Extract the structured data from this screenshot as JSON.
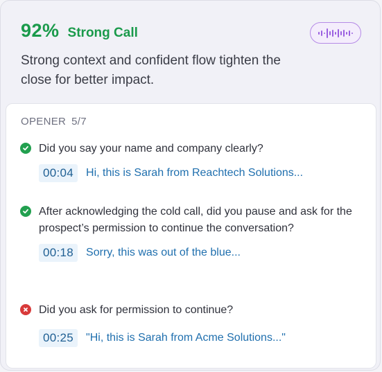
{
  "header": {
    "score": "92%",
    "rating": "Strong Call",
    "summary": "Strong context and confident flow tighten the close for better impact.",
    "audio_icon": "waveform-icon"
  },
  "section": {
    "name": "OPENER",
    "count": "5/7"
  },
  "items": [
    {
      "status": "passed",
      "status_icon": "check-circle-icon",
      "question": "Did you say your name and company clearly?",
      "timestamp": "00:04",
      "quote": "Hi, this is Sarah from Reachtech Solutions..."
    },
    {
      "status": "passed",
      "status_icon": "check-circle-icon",
      "question": "After acknowledging the cold call, did you pause and ask for the prospect’s permission to continue the conversation?",
      "timestamp": "00:18",
      "quote": "Sorry, this was out of the blue..."
    },
    {
      "status": "failed",
      "status_icon": "x-circle-icon",
      "question": "Did you ask for permission to continue?",
      "timestamp": "00:25",
      "quote": "\"Hi, this is Sarah from Acme Solutions...\""
    }
  ],
  "colors": {
    "success": "#1a9a4b",
    "fail": "#d83a3a",
    "link": "#1f6fae",
    "accent": "#b58ae6"
  }
}
